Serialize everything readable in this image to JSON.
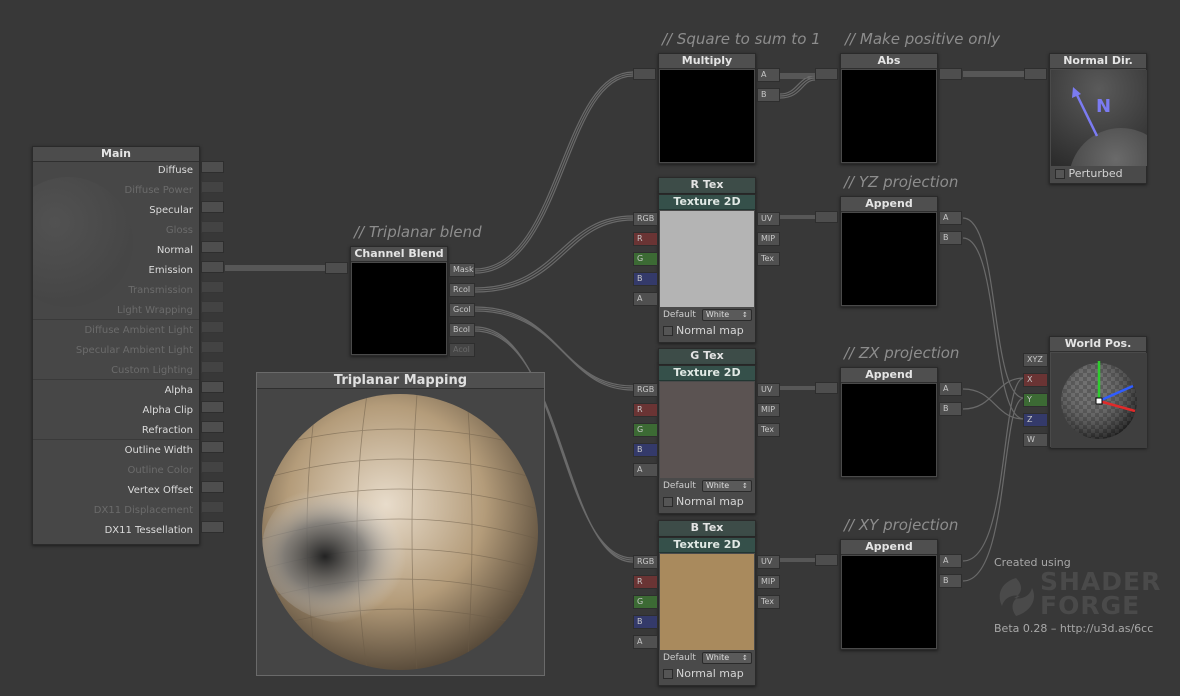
{
  "comments": {
    "square": "// Square to sum to 1",
    "positive": "// Make positive only",
    "triplanar": "// Triplanar blend",
    "yz": "// YZ projection",
    "zx": "// ZX projection",
    "xy": "// XY projection"
  },
  "main": {
    "title": "Main",
    "inputs": [
      {
        "label": "Diffuse",
        "enabled": true
      },
      {
        "label": "Diffuse Power",
        "enabled": false
      },
      {
        "label": "Specular",
        "enabled": true
      },
      {
        "label": "Gloss",
        "enabled": false
      },
      {
        "label": "Normal",
        "enabled": true
      },
      {
        "label": "Emission",
        "enabled": true
      },
      {
        "label": "Transmission",
        "enabled": false
      },
      {
        "label": "Light Wrapping",
        "enabled": false
      },
      {
        "label": "Diffuse Ambient Light",
        "enabled": false
      },
      {
        "label": "Specular Ambient Light",
        "enabled": false
      },
      {
        "label": "Custom Lighting",
        "enabled": false
      },
      {
        "label": "Alpha",
        "enabled": true
      },
      {
        "label": "Alpha Clip",
        "enabled": true
      },
      {
        "label": "Refraction",
        "enabled": true
      },
      {
        "label": "Outline Width",
        "enabled": true
      },
      {
        "label": "Outline Color",
        "enabled": false
      },
      {
        "label": "Vertex Offset",
        "enabled": true
      },
      {
        "label": "DX11 Displacement",
        "enabled": false
      },
      {
        "label": "DX11 Tessellation",
        "enabled": true
      }
    ]
  },
  "channel_blend": {
    "title": "Channel Blend",
    "outputs": [
      "Mask",
      "Rcol",
      "Gcol",
      "Bcol",
      "Acol"
    ]
  },
  "triplanar_preview": {
    "title": "Triplanar Mapping"
  },
  "multiply": {
    "title": "Multiply",
    "outputs": [
      "A",
      "B"
    ]
  },
  "abs": {
    "title": "Abs"
  },
  "normal_dir": {
    "title": "Normal Dir.",
    "axis_label": "N",
    "perturbed_label": "Perturbed"
  },
  "tex_nodes": [
    {
      "header": "R Tex",
      "title": "Texture 2D",
      "inputs": [
        "RGB",
        "R",
        "G",
        "B",
        "A"
      ],
      "outputs": [
        "UV",
        "MIP",
        "Tex"
      ],
      "default_label": "Default",
      "default_value": "White",
      "normal_map_label": "Normal map",
      "preview_color": "#b4b4b4"
    },
    {
      "header": "G Tex",
      "title": "Texture 2D",
      "inputs": [
        "RGB",
        "R",
        "G",
        "B",
        "A"
      ],
      "outputs": [
        "UV",
        "MIP",
        "Tex"
      ],
      "default_label": "Default",
      "default_value": "White",
      "normal_map_label": "Normal map",
      "preview_color": "#5b5352"
    },
    {
      "header": "B Tex",
      "title": "Texture 2D",
      "inputs": [
        "RGB",
        "R",
        "G",
        "B",
        "A"
      ],
      "outputs": [
        "UV",
        "MIP",
        "Tex"
      ],
      "default_label": "Default",
      "default_value": "White",
      "normal_map_label": "Normal map",
      "preview_color": "#a98a5d"
    }
  ],
  "append_nodes": [
    {
      "title": "Append",
      "outputs": [
        "A",
        "B"
      ]
    },
    {
      "title": "Append",
      "outputs": [
        "A",
        "B"
      ]
    },
    {
      "title": "Append",
      "outputs": [
        "A",
        "B"
      ]
    }
  ],
  "world_pos": {
    "title": "World Pos.",
    "outputs": [
      "XYZ",
      "X",
      "Y",
      "Z",
      "W"
    ]
  },
  "credits": {
    "created_using": "Created using",
    "logo_line1": "SHADER",
    "logo_line2": "FORGE",
    "version": "Beta 0.28 – http://u3d.as/6cc"
  },
  "colors": {
    "background": "#383838",
    "port_red": "#6a3434",
    "port_green": "#3c6a34",
    "port_blue": "#343a6a",
    "header_green": "#35504a",
    "normal_arrow": "#7b7bf2"
  }
}
